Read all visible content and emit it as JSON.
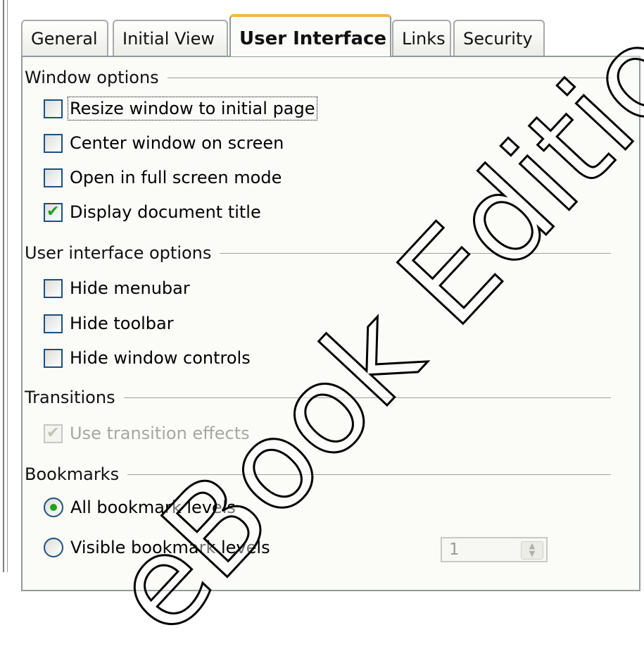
{
  "tabs": [
    {
      "label": "General",
      "active": false
    },
    {
      "label": "Initial View",
      "active": false
    },
    {
      "label": "User Interface",
      "active": true
    },
    {
      "label": "Links",
      "active": false
    },
    {
      "label": "Security",
      "active": false
    }
  ],
  "sections": {
    "window_options": {
      "title": "Window options",
      "items": [
        {
          "label": "Resize window to initial page",
          "checked": false
        },
        {
          "label": "Center window on screen",
          "checked": false
        },
        {
          "label": "Open in full screen mode",
          "checked": false
        },
        {
          "label": "Display document title",
          "checked": true
        }
      ]
    },
    "ui_options": {
      "title": "User interface options",
      "items": [
        {
          "label": "Hide menubar",
          "checked": false
        },
        {
          "label": "Hide toolbar",
          "checked": false
        },
        {
          "label": "Hide window controls",
          "checked": false
        }
      ]
    },
    "transitions": {
      "title": "Transitions",
      "items": [
        {
          "label": "Use transition effects",
          "checked": true,
          "disabled": true
        }
      ]
    },
    "bookmarks": {
      "title": "Bookmarks",
      "items": [
        {
          "label": "All bookmark levels",
          "selected": true
        },
        {
          "label": "Visible bookmark levels",
          "selected": false
        }
      ],
      "levels_value": "1"
    }
  },
  "watermark": "eBook Edition",
  "colors": {
    "accent_check": "#21a121",
    "tab_highlight": "#f5b54a",
    "control_border": "#1c5180"
  }
}
